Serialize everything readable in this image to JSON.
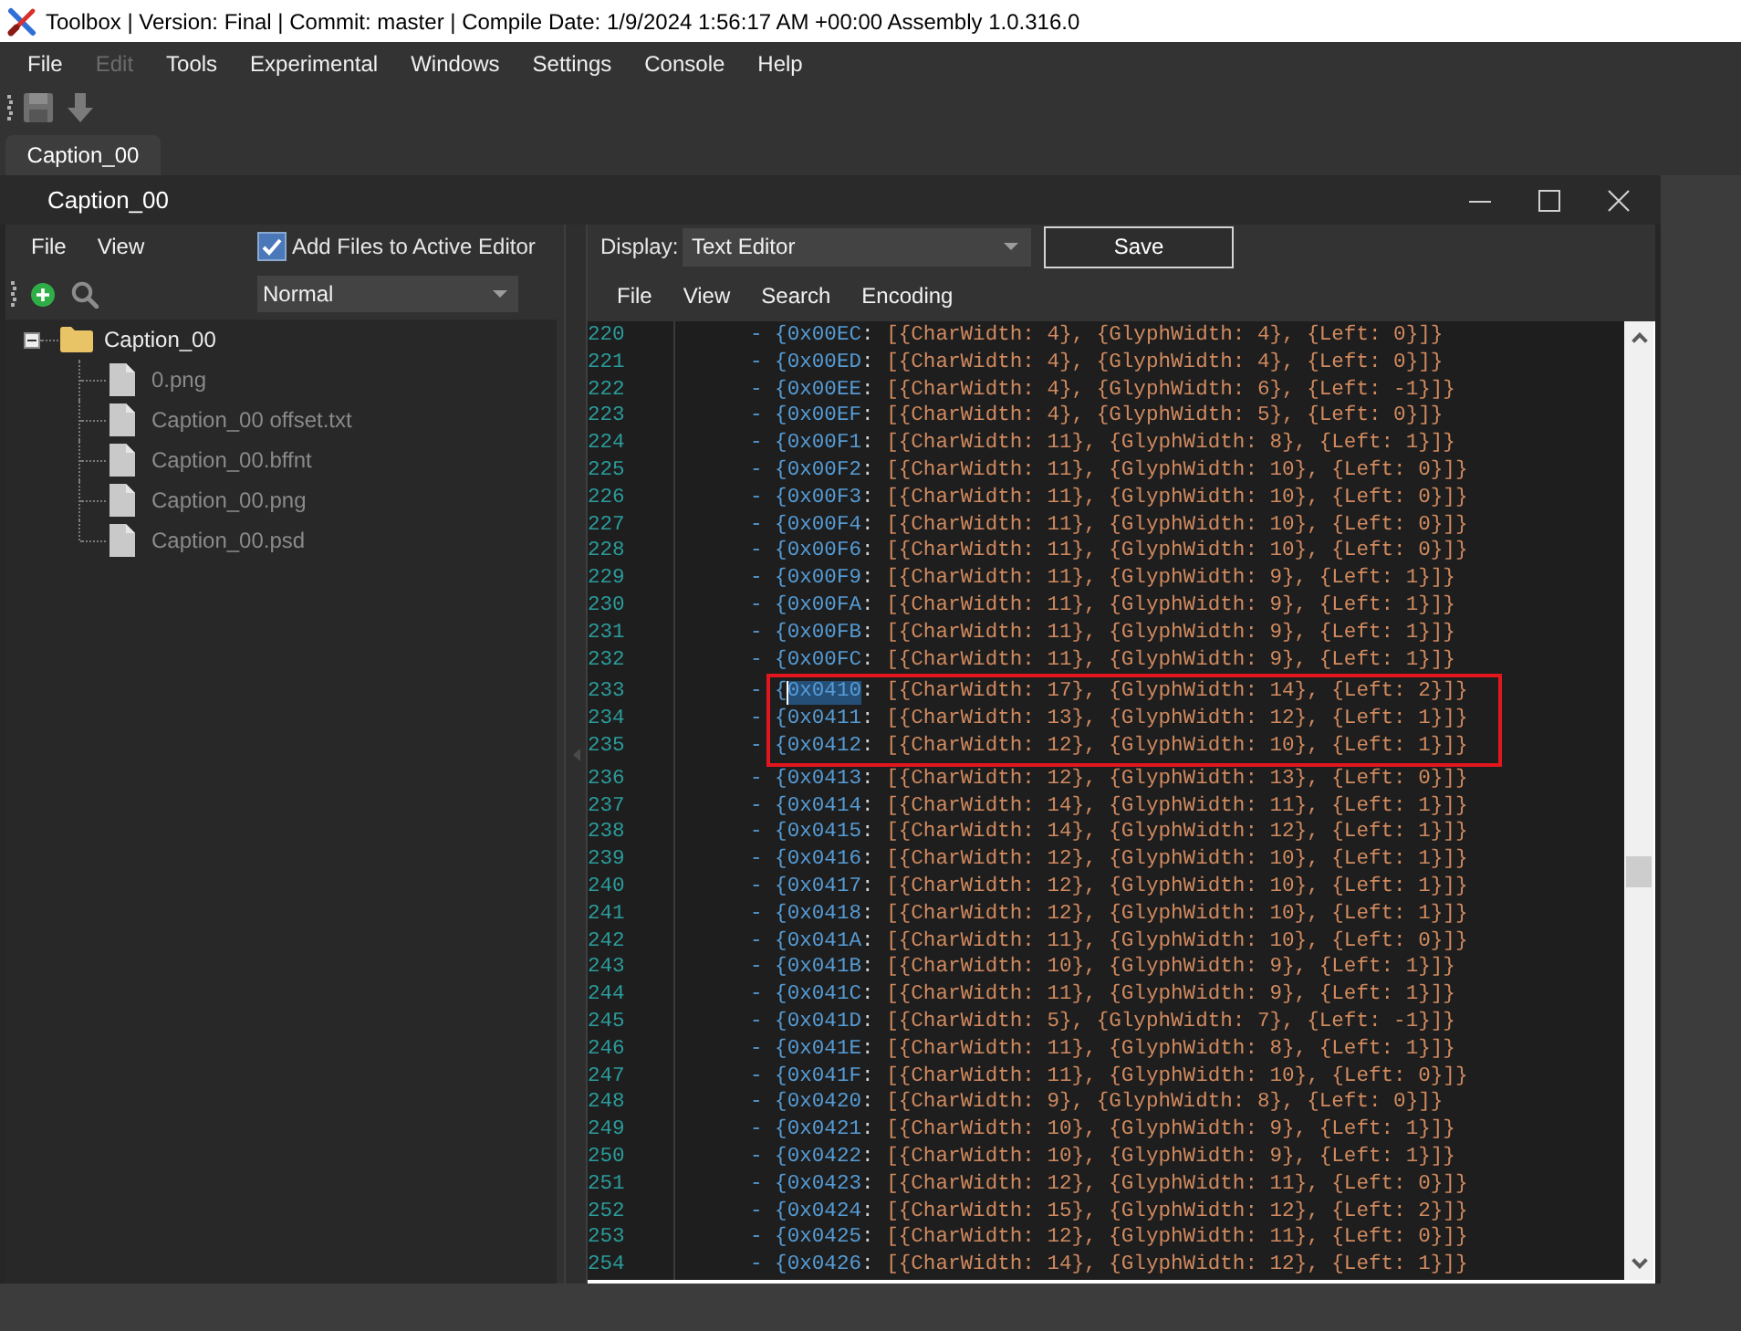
{
  "window": {
    "title": "Toolbox | Version: Final | Commit: master | Compile Date: 1/9/2024 1:56:17 AM +00:00 Assembly 1.0.316.0"
  },
  "menu_bar": [
    {
      "label": "File",
      "disabled": false
    },
    {
      "label": "Edit",
      "disabled": true
    },
    {
      "label": "Tools",
      "disabled": false
    },
    {
      "label": "Experimental",
      "disabled": false
    },
    {
      "label": "Windows",
      "disabled": false
    },
    {
      "label": "Settings",
      "disabled": false
    },
    {
      "label": "Console",
      "disabled": false
    },
    {
      "label": "Help",
      "disabled": false
    }
  ],
  "toolbar": [
    {
      "kind": "save",
      "disabled": true
    },
    {
      "kind": "download",
      "disabled": true
    }
  ],
  "document_tabs": [
    {
      "label": "Caption_00",
      "selected": true
    }
  ],
  "editor_window": {
    "title": "Caption_00",
    "file_panel": {
      "menu": [
        "File",
        "View"
      ],
      "add_to_active_editor": {
        "label": "Add Files to Active Editor",
        "checked": true
      },
      "mode_dropdown": {
        "value": "Normal"
      },
      "tree": [
        {
          "label": "Caption_00",
          "kind": "folder",
          "expanded": true,
          "children": [
            {
              "label": "0.png",
              "kind": "file"
            },
            {
              "label": "Caption_00 offset.txt",
              "kind": "file"
            },
            {
              "label": "Caption_00.bffnt",
              "kind": "file"
            },
            {
              "label": "Caption_00.png",
              "kind": "file"
            },
            {
              "label": "Caption_00.psd",
              "kind": "file"
            }
          ]
        }
      ]
    },
    "text_panel": {
      "display_label": "Display:",
      "display_dropdown": {
        "value": "Text Editor"
      },
      "save_button": "Save",
      "menu": [
        "File",
        "View",
        "Search",
        "Encoding"
      ],
      "lines": [
        {
          "number": "220",
          "prefix": "- {",
          "key": "0x00EC",
          "colon": ":",
          "value": "[{CharWidth: 4}, {GlyphWidth: 4}, {Left: 0}]}",
          "selected": false,
          "boxed": false
        },
        {
          "number": "221",
          "prefix": "- {",
          "key": "0x00ED",
          "colon": ":",
          "value": "[{CharWidth: 4}, {GlyphWidth: 4}, {Left: 0}]}",
          "selected": false,
          "boxed": false
        },
        {
          "number": "222",
          "prefix": "- {",
          "key": "0x00EE",
          "colon": ":",
          "value": "[{CharWidth: 4}, {GlyphWidth: 6}, {Left: -1}]}",
          "selected": false,
          "boxed": false
        },
        {
          "number": "223",
          "prefix": "- {",
          "key": "0x00EF",
          "colon": ":",
          "value": "[{CharWidth: 4}, {GlyphWidth: 5}, {Left: 0}]}",
          "selected": false,
          "boxed": false
        },
        {
          "number": "224",
          "prefix": "- {",
          "key": "0x00F1",
          "colon": ":",
          "value": "[{CharWidth: 11}, {GlyphWidth: 8}, {Left: 1}]}",
          "selected": false,
          "boxed": false
        },
        {
          "number": "225",
          "prefix": "- {",
          "key": "0x00F2",
          "colon": ":",
          "value": "[{CharWidth: 11}, {GlyphWidth: 10}, {Left: 0}]}",
          "selected": false,
          "boxed": false
        },
        {
          "number": "226",
          "prefix": "- {",
          "key": "0x00F3",
          "colon": ":",
          "value": "[{CharWidth: 11}, {GlyphWidth: 10}, {Left: 0}]}",
          "selected": false,
          "boxed": false
        },
        {
          "number": "227",
          "prefix": "- {",
          "key": "0x00F4",
          "colon": ":",
          "value": "[{CharWidth: 11}, {GlyphWidth: 10}, {Left: 0}]}",
          "selected": false,
          "boxed": false
        },
        {
          "number": "228",
          "prefix": "- {",
          "key": "0x00F6",
          "colon": ":",
          "value": "[{CharWidth: 11}, {GlyphWidth: 10}, {Left: 0}]}",
          "selected": false,
          "boxed": false
        },
        {
          "number": "229",
          "prefix": "- {",
          "key": "0x00F9",
          "colon": ":",
          "value": "[{CharWidth: 11}, {GlyphWidth: 9}, {Left: 1}]}",
          "selected": false,
          "boxed": false
        },
        {
          "number": "230",
          "prefix": "- {",
          "key": "0x00FA",
          "colon": ":",
          "value": "[{CharWidth: 11}, {GlyphWidth: 9}, {Left: 1}]}",
          "selected": false,
          "boxed": false
        },
        {
          "number": "231",
          "prefix": "- {",
          "key": "0x00FB",
          "colon": ":",
          "value": "[{CharWidth: 11}, {GlyphWidth: 9}, {Left: 1}]}",
          "selected": false,
          "boxed": false
        },
        {
          "number": "232",
          "prefix": "- {",
          "key": "0x00FC",
          "colon": ":",
          "value": "[{CharWidth: 11}, {GlyphWidth: 9}, {Left: 1}]}",
          "selected": false,
          "boxed": false
        },
        {
          "number": "233",
          "prefix": "- {",
          "key": "0x0410",
          "colon": ":",
          "value": "[{CharWidth: 17}, {GlyphWidth: 14}, {Left: 2}]}",
          "selected": true,
          "boxed": true
        },
        {
          "number": "234",
          "prefix": "- {",
          "key": "0x0411",
          "colon": ":",
          "value": "[{CharWidth: 13}, {GlyphWidth: 12}, {Left: 1}]}",
          "selected": false,
          "boxed": true
        },
        {
          "number": "235",
          "prefix": "- {",
          "key": "0x0412",
          "colon": ":",
          "value": "[{CharWidth: 12}, {GlyphWidth: 10}, {Left: 1}]}",
          "selected": false,
          "boxed": true
        },
        {
          "number": "236",
          "prefix": "- {",
          "key": "0x0413",
          "colon": ":",
          "value": "[{CharWidth: 12}, {GlyphWidth: 13}, {Left: 0}]}",
          "selected": false,
          "boxed": false
        },
        {
          "number": "237",
          "prefix": "- {",
          "key": "0x0414",
          "colon": ":",
          "value": "[{CharWidth: 14}, {GlyphWidth: 11}, {Left: 1}]}",
          "selected": false,
          "boxed": false
        },
        {
          "number": "238",
          "prefix": "- {",
          "key": "0x0415",
          "colon": ":",
          "value": "[{CharWidth: 14}, {GlyphWidth: 12}, {Left: 1}]}",
          "selected": false,
          "boxed": false
        },
        {
          "number": "239",
          "prefix": "- {",
          "key": "0x0416",
          "colon": ":",
          "value": "[{CharWidth: 12}, {GlyphWidth: 10}, {Left: 1}]}",
          "selected": false,
          "boxed": false
        },
        {
          "number": "240",
          "prefix": "- {",
          "key": "0x0417",
          "colon": ":",
          "value": "[{CharWidth: 12}, {GlyphWidth: 10}, {Left: 1}]}",
          "selected": false,
          "boxed": false
        },
        {
          "number": "241",
          "prefix": "- {",
          "key": "0x0418",
          "colon": ":",
          "value": "[{CharWidth: 12}, {GlyphWidth: 10}, {Left: 1}]}",
          "selected": false,
          "boxed": false
        },
        {
          "number": "242",
          "prefix": "- {",
          "key": "0x041A",
          "colon": ":",
          "value": "[{CharWidth: 11}, {GlyphWidth: 10}, {Left: 0}]}",
          "selected": false,
          "boxed": false
        },
        {
          "number": "243",
          "prefix": "- {",
          "key": "0x041B",
          "colon": ":",
          "value": "[{CharWidth: 10}, {GlyphWidth: 9}, {Left: 1}]}",
          "selected": false,
          "boxed": false
        },
        {
          "number": "244",
          "prefix": "- {",
          "key": "0x041C",
          "colon": ":",
          "value": "[{CharWidth: 11}, {GlyphWidth: 9}, {Left: 1}]}",
          "selected": false,
          "boxed": false
        },
        {
          "number": "245",
          "prefix": "- {",
          "key": "0x041D",
          "colon": ":",
          "value": "[{CharWidth: 5}, {GlyphWidth: 7}, {Left: -1}]}",
          "selected": false,
          "boxed": false
        },
        {
          "number": "246",
          "prefix": "- {",
          "key": "0x041E",
          "colon": ":",
          "value": "[{CharWidth: 11}, {GlyphWidth: 8}, {Left: 1}]}",
          "selected": false,
          "boxed": false
        },
        {
          "number": "247",
          "prefix": "- {",
          "key": "0x041F",
          "colon": ":",
          "value": "[{CharWidth: 11}, {GlyphWidth: 10}, {Left: 0}]}",
          "selected": false,
          "boxed": false
        },
        {
          "number": "248",
          "prefix": "- {",
          "key": "0x0420",
          "colon": ":",
          "value": "[{CharWidth: 9}, {GlyphWidth: 8}, {Left: 0}]}",
          "selected": false,
          "boxed": false
        },
        {
          "number": "249",
          "prefix": "- {",
          "key": "0x0421",
          "colon": ":",
          "value": "[{CharWidth: 10}, {GlyphWidth: 9}, {Left: 1}]}",
          "selected": false,
          "boxed": false
        },
        {
          "number": "250",
          "prefix": "- {",
          "key": "0x0422",
          "colon": ":",
          "value": "[{CharWidth: 10}, {GlyphWidth: 9}, {Left: 1}]}",
          "selected": false,
          "boxed": false
        },
        {
          "number": "251",
          "prefix": "- {",
          "key": "0x0423",
          "colon": ":",
          "value": "[{CharWidth: 12}, {GlyphWidth: 11}, {Left: 0}]}",
          "selected": false,
          "boxed": false
        },
        {
          "number": "252",
          "prefix": "- {",
          "key": "0x0424",
          "colon": ":",
          "value": "[{CharWidth: 15}, {GlyphWidth: 12}, {Left: 2}]}",
          "selected": false,
          "boxed": false
        },
        {
          "number": "253",
          "prefix": "- {",
          "key": "0x0425",
          "colon": ":",
          "value": "[{CharWidth: 12}, {GlyphWidth: 11}, {Left: 0}]}",
          "selected": false,
          "boxed": false
        },
        {
          "number": "254",
          "prefix": "- {",
          "key": "0x0426",
          "colon": ":",
          "value": "[{CharWidth: 14}, {GlyphWidth: 12}, {Left: 1}]}",
          "selected": false,
          "boxed": false
        }
      ]
    }
  }
}
